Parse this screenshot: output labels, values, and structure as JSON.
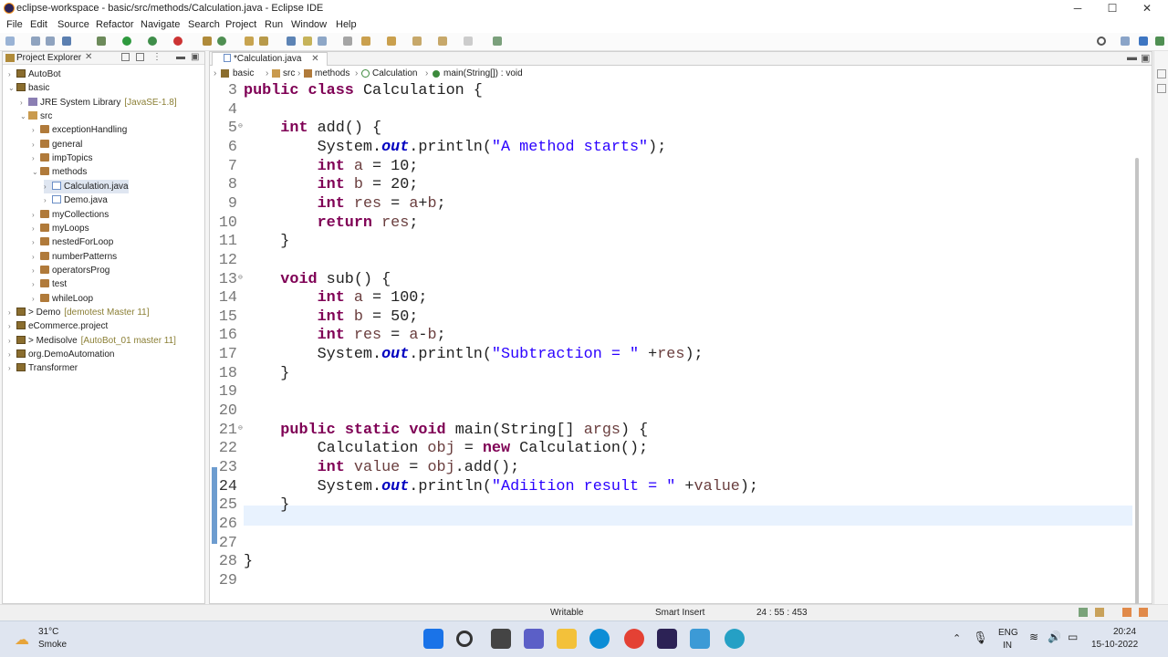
{
  "window": {
    "title": "eclipse-workspace - basic/src/methods/Calculation.java - Eclipse IDE",
    "controls": [
      "─",
      "☐",
      "✕"
    ]
  },
  "menu": [
    "File",
    "Edit",
    "Source",
    "Refactor",
    "Navigate",
    "Search",
    "Project",
    "Run",
    "Window",
    "Help"
  ],
  "project_explorer": {
    "title": "Project Explorer",
    "tree": [
      {
        "label": "AutoBot",
        "indent": 0,
        "twisty": "›",
        "icon": "prj"
      },
      {
        "label": "basic",
        "indent": 0,
        "twisty": "⌄",
        "icon": "prj"
      },
      {
        "label": "JRE System Library",
        "decor": "[JavaSE-1.8]",
        "indent": 1,
        "twisty": "›",
        "icon": "lib"
      },
      {
        "label": "src",
        "indent": 1,
        "twisty": "⌄",
        "icon": "srcf"
      },
      {
        "label": "exceptionHandling",
        "indent": 2,
        "twisty": "›",
        "icon": "pkg"
      },
      {
        "label": "general",
        "indent": 2,
        "twisty": "›",
        "icon": "pkg"
      },
      {
        "label": "impTopics",
        "indent": 2,
        "twisty": "›",
        "icon": "pkg"
      },
      {
        "label": "methods",
        "indent": 2,
        "twisty": "⌄",
        "icon": "pkg"
      },
      {
        "label": "Calculation.java",
        "indent": 3,
        "twisty": "›",
        "icon": "jfile",
        "selected": true
      },
      {
        "label": "Demo.java",
        "indent": 3,
        "twisty": "›",
        "icon": "jfile"
      },
      {
        "label": "myCollections",
        "indent": 2,
        "twisty": "›",
        "icon": "pkg"
      },
      {
        "label": "myLoops",
        "indent": 2,
        "twisty": "›",
        "icon": "pkg"
      },
      {
        "label": "nestedForLoop",
        "indent": 2,
        "twisty": "›",
        "icon": "pkg"
      },
      {
        "label": "numberPatterns",
        "indent": 2,
        "twisty": "›",
        "icon": "pkg"
      },
      {
        "label": "operatorsProg",
        "indent": 2,
        "twisty": "›",
        "icon": "pkg"
      },
      {
        "label": "test",
        "indent": 2,
        "twisty": "›",
        "icon": "pkg"
      },
      {
        "label": "whileLoop",
        "indent": 2,
        "twisty": "›",
        "icon": "pkg"
      },
      {
        "label": "> Demo",
        "decor": "[demotest Master 11]",
        "indent": 0,
        "twisty": "›",
        "icon": "prj"
      },
      {
        "label": "eCommerce.project",
        "indent": 0,
        "twisty": "›",
        "icon": "prj"
      },
      {
        "label": "> Medisolve",
        "decor": "[AutoBot_01 master 11]",
        "indent": 0,
        "twisty": "›",
        "icon": "prj"
      },
      {
        "label": "org.DemoAutomation",
        "indent": 0,
        "twisty": "›",
        "icon": "prj"
      },
      {
        "label": "Transformer",
        "indent": 0,
        "twisty": "›",
        "icon": "prj"
      }
    ]
  },
  "editor": {
    "tab_label": "*Calculation.java",
    "breadcrumb": [
      "basic",
      "src",
      "methods",
      "Calculation",
      "main(String[]) : void"
    ],
    "lines": [
      {
        "n": "3",
        "tokens": [
          [
            "kw",
            "public"
          ],
          [
            "t",
            " "
          ],
          [
            "kw",
            "class"
          ],
          [
            "t",
            " Calculation {"
          ]
        ]
      },
      {
        "n": "4",
        "tokens": []
      },
      {
        "n": "5",
        "fold": true,
        "tokens": [
          [
            "t",
            "    "
          ],
          [
            "kw",
            "int"
          ],
          [
            "t",
            " add() {"
          ]
        ]
      },
      {
        "n": "6",
        "tokens": [
          [
            "t",
            "        System."
          ],
          [
            "fld",
            "out"
          ],
          [
            "t",
            ".println("
          ],
          [
            "str",
            "\"A method starts\""
          ],
          [
            "t",
            ");"
          ]
        ]
      },
      {
        "n": "7",
        "tokens": [
          [
            "t",
            "        "
          ],
          [
            "kw",
            "int"
          ],
          [
            "t",
            " "
          ],
          [
            "var",
            "a"
          ],
          [
            "t",
            " = 10;"
          ]
        ]
      },
      {
        "n": "8",
        "tokens": [
          [
            "t",
            "        "
          ],
          [
            "kw",
            "int"
          ],
          [
            "t",
            " "
          ],
          [
            "var",
            "b"
          ],
          [
            "t",
            " = 20;"
          ]
        ]
      },
      {
        "n": "9",
        "tokens": [
          [
            "t",
            "        "
          ],
          [
            "kw",
            "int"
          ],
          [
            "t",
            " "
          ],
          [
            "var",
            "res"
          ],
          [
            "t",
            " = "
          ],
          [
            "var",
            "a"
          ],
          [
            "t",
            "+"
          ],
          [
            "var",
            "b"
          ],
          [
            "t",
            ";"
          ]
        ]
      },
      {
        "n": "10",
        "tokens": [
          [
            "t",
            "        "
          ],
          [
            "kw",
            "return"
          ],
          [
            "t",
            " "
          ],
          [
            "var",
            "res"
          ],
          [
            "t",
            ";"
          ]
        ]
      },
      {
        "n": "11",
        "tokens": [
          [
            "t",
            "    }"
          ]
        ]
      },
      {
        "n": "12",
        "tokens": []
      },
      {
        "n": "13",
        "fold": true,
        "tokens": [
          [
            "t",
            "    "
          ],
          [
            "kw",
            "void"
          ],
          [
            "t",
            " sub() {"
          ]
        ]
      },
      {
        "n": "14",
        "tokens": [
          [
            "t",
            "        "
          ],
          [
            "kw",
            "int"
          ],
          [
            "t",
            " "
          ],
          [
            "var",
            "a"
          ],
          [
            "t",
            " = 100;"
          ]
        ]
      },
      {
        "n": "15",
        "tokens": [
          [
            "t",
            "        "
          ],
          [
            "kw",
            "int"
          ],
          [
            "t",
            " "
          ],
          [
            "var",
            "b"
          ],
          [
            "t",
            " = 50;"
          ]
        ]
      },
      {
        "n": "16",
        "tokens": [
          [
            "t",
            "        "
          ],
          [
            "kw",
            "int"
          ],
          [
            "t",
            " "
          ],
          [
            "var",
            "res"
          ],
          [
            "t",
            " = "
          ],
          [
            "var",
            "a"
          ],
          [
            "t",
            "-"
          ],
          [
            "var",
            "b"
          ],
          [
            "t",
            ";"
          ]
        ]
      },
      {
        "n": "17",
        "tokens": [
          [
            "t",
            "        System."
          ],
          [
            "fld",
            "out"
          ],
          [
            "t",
            ".println("
          ],
          [
            "str",
            "\"Subtraction = \""
          ],
          [
            "t",
            " +"
          ],
          [
            "var",
            "res"
          ],
          [
            "t",
            ");"
          ]
        ]
      },
      {
        "n": "18",
        "tokens": [
          [
            "t",
            "    }"
          ]
        ]
      },
      {
        "n": "19",
        "tokens": []
      },
      {
        "n": "20",
        "tokens": []
      },
      {
        "n": "21",
        "fold": true,
        "tokens": [
          [
            "t",
            "    "
          ],
          [
            "kw",
            "public"
          ],
          [
            "t",
            " "
          ],
          [
            "kw",
            "static"
          ],
          [
            "t",
            " "
          ],
          [
            "kw",
            "void"
          ],
          [
            "t",
            " main(String[] "
          ],
          [
            "var",
            "args"
          ],
          [
            "t",
            ") {"
          ]
        ]
      },
      {
        "n": "22",
        "tokens": [
          [
            "t",
            "        Calculation "
          ],
          [
            "var",
            "obj"
          ],
          [
            "t",
            " = "
          ],
          [
            "kw",
            "new"
          ],
          [
            "t",
            " Calculation();"
          ]
        ]
      },
      {
        "n": "23",
        "tokens": [
          [
            "t",
            "        "
          ],
          [
            "kw",
            "int"
          ],
          [
            "t",
            " "
          ],
          [
            "var",
            "value"
          ],
          [
            "t",
            " = "
          ],
          [
            "var",
            "obj"
          ],
          [
            "t",
            ".add();"
          ]
        ]
      },
      {
        "n": "24",
        "current": true,
        "tokens": [
          [
            "t",
            "        System."
          ],
          [
            "fld",
            "out"
          ],
          [
            "t",
            ".println("
          ],
          [
            "str",
            "\"Adiition result = \""
          ],
          [
            "t",
            " +"
          ],
          [
            "var",
            "value"
          ],
          [
            "t",
            ");"
          ]
        ]
      },
      {
        "n": "25",
        "tokens": [
          [
            "t",
            "    }"
          ]
        ]
      },
      {
        "n": "26",
        "tokens": []
      },
      {
        "n": "27",
        "tokens": []
      },
      {
        "n": "28",
        "tokens": [
          [
            "t",
            "}"
          ]
        ]
      },
      {
        "n": "29",
        "tokens": []
      }
    ]
  },
  "status": {
    "writable": "Writable",
    "insert_mode": "Smart Insert",
    "position": "24 : 55 : 453"
  },
  "taskbar": {
    "temp": "31°C",
    "weather": "Smoke",
    "lang": "ENG",
    "region": "IN",
    "time": "20:24",
    "date": "15-10-2022"
  }
}
